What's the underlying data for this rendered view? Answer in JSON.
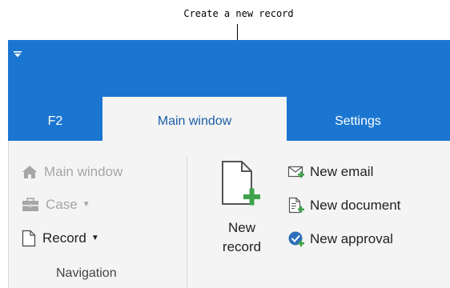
{
  "annotation": {
    "text": "Create a new record"
  },
  "quick_access": {
    "icon": "quick-access-dropdown-icon"
  },
  "tabs": [
    {
      "label": "F2",
      "icon": ""
    },
    {
      "label": "Main window",
      "active": true
    },
    {
      "label": "Settings"
    }
  ],
  "navigation": {
    "group_label": "Navigation",
    "items": [
      {
        "label": "Main window",
        "icon": "home-icon",
        "enabled": false
      },
      {
        "label": "Case",
        "icon": "case-icon",
        "enabled": false,
        "has_dropdown": true
      },
      {
        "label": "Record",
        "icon": "document-icon",
        "enabled": true,
        "has_dropdown": true
      }
    ]
  },
  "new_record": {
    "label_line1": "New",
    "label_line2": "record",
    "icon": "new-record-icon"
  },
  "new_items": [
    {
      "label": "New email",
      "icon": "email-icon"
    },
    {
      "label": "New document",
      "icon": "new-document-icon"
    },
    {
      "label": "New approval",
      "icon": "approval-icon"
    }
  ],
  "colors": {
    "accent": "#1b76d1",
    "ribbon": "#f4f4f4",
    "active_tab_text": "#1b5fa6",
    "plus_green": "#3fa34d"
  }
}
